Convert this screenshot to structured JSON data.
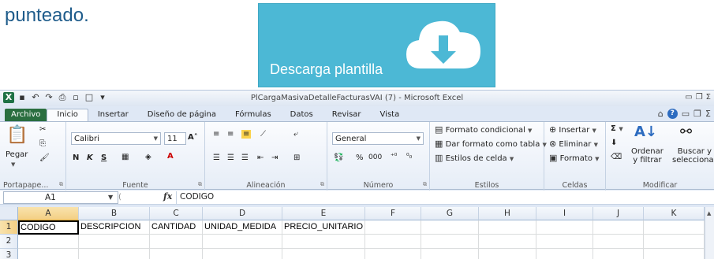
{
  "doc": {
    "partial_text": "punteado."
  },
  "download": {
    "label": "Descarga plantilla",
    "icon": "cloud-download-icon"
  },
  "window": {
    "title": "PlCargaMasivaDetalleFacturasVAI (7) - Microsoft Excel"
  },
  "menu": {
    "tabs": [
      "Archivo",
      "Inicio",
      "Insertar",
      "Diseño de página",
      "Fórmulas",
      "Datos",
      "Revisar",
      "Vista"
    ],
    "active": "Inicio"
  },
  "ribbon": {
    "clipboard": {
      "paste": "Pegar",
      "label": "Portapape..."
    },
    "font": {
      "name": "Calibri",
      "size": "11",
      "bold": "N",
      "italic": "K",
      "underline": "S",
      "label": "Fuente"
    },
    "alignment": {
      "label": "Alineación"
    },
    "number": {
      "format": "General",
      "percent": "%",
      "thousands": "000",
      "label": "Número"
    },
    "styles": {
      "conditional": "Formato condicional",
      "as_table": "Dar formato como tabla",
      "cell_styles": "Estilos de celda",
      "label": "Estilos"
    },
    "cells": {
      "insert": "Insertar",
      "delete": "Eliminar",
      "format": "Formato",
      "label": "Celdas"
    },
    "editing": {
      "sum": "Σ",
      "sort": "Ordenar",
      "sort2": "y filtrar",
      "find": "Buscar y",
      "find2": "seleccionar",
      "label": "Modificar"
    }
  },
  "formula_bar": {
    "name_box": "A1",
    "fx": "fx",
    "formula": "CODIGO"
  },
  "sheet": {
    "columns": [
      "A",
      "B",
      "C",
      "D",
      "E",
      "F",
      "G",
      "H",
      "I",
      "J",
      "K"
    ],
    "rows": [
      "1",
      "2",
      "3"
    ],
    "row1": [
      "CODIGO",
      "DESCRIPCION",
      "CANTIDAD",
      "UNIDAD_MEDIDA",
      "PRECIO_UNITARIO"
    ]
  }
}
